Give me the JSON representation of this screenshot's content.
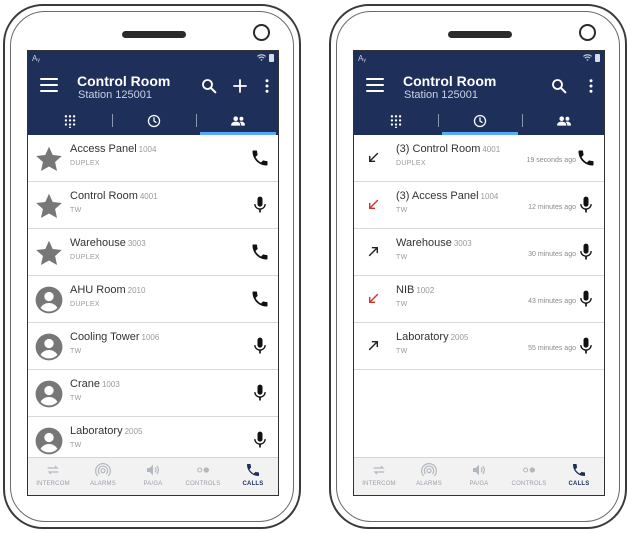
{
  "status_left": "Aᵧ",
  "status_right_icon": "wifi-icon",
  "header": {
    "title": "Control Room",
    "subtitle": "Station 125001"
  },
  "colors": {
    "brand": "#1e2f5a",
    "tab_indicator": "#5aa9ff",
    "missed": "#d0342c"
  },
  "tabs": [
    {
      "icon": "dialpad-icon"
    },
    {
      "icon": "clock-icon"
    },
    {
      "icon": "contacts-icon"
    }
  ],
  "left_list": [
    {
      "name": "Access Panel",
      "number": "1004",
      "type": "DUPLEX",
      "avatar": "star-icon",
      "action": "phone-icon"
    },
    {
      "name": "Control Room",
      "number": "4001",
      "type": "TW",
      "avatar": "star-icon",
      "action": "mic-icon"
    },
    {
      "name": "Warehouse",
      "number": "3003",
      "type": "DUPLEX",
      "avatar": "star-icon",
      "action": "phone-icon"
    },
    {
      "name": "AHU Room",
      "number": "2010",
      "type": "DUPLEX",
      "avatar": "person-icon",
      "action": "phone-icon"
    },
    {
      "name": "Cooling Tower",
      "number": "1006",
      "type": "TW",
      "avatar": "person-icon",
      "action": "mic-icon"
    },
    {
      "name": "Crane",
      "number": "1003",
      "type": "TW",
      "avatar": "person-icon",
      "action": "mic-icon"
    },
    {
      "name": "Laboratory",
      "number": "2005",
      "type": "TW",
      "avatar": "person-icon",
      "action": "mic-icon"
    }
  ],
  "right_list": [
    {
      "name": "(3) Control Room",
      "number": "4001",
      "type": "DUPLEX",
      "time": "19 seconds ago",
      "direction": "incoming",
      "action": "phone-icon"
    },
    {
      "name": "(3) Access Panel",
      "number": "1004",
      "type": "TW",
      "time": "12 minutes ago",
      "direction": "missed",
      "action": "mic-icon"
    },
    {
      "name": "Warehouse",
      "number": "3003",
      "type": "TW",
      "time": "30 minutes ago",
      "direction": "outgoing",
      "action": "mic-icon"
    },
    {
      "name": "NIB",
      "number": "1002",
      "type": "TW",
      "time": "43 minutes ago",
      "direction": "missed",
      "action": "mic-icon"
    },
    {
      "name": "Laboratory",
      "number": "2005",
      "type": "TW",
      "time": "55 minutes ago",
      "direction": "outgoing",
      "action": "mic-icon"
    }
  ],
  "bottom_nav": [
    {
      "label": "INTERCOM",
      "icon": "swap-arrows-icon"
    },
    {
      "label": "ALARMS",
      "icon": "alarm-icon"
    },
    {
      "label": "PA/GA",
      "icon": "speaker-icon"
    },
    {
      "label": "CONTROLS",
      "icon": "toggle-icon"
    },
    {
      "label": "CALLS",
      "icon": "phone-icon",
      "active": true
    }
  ]
}
